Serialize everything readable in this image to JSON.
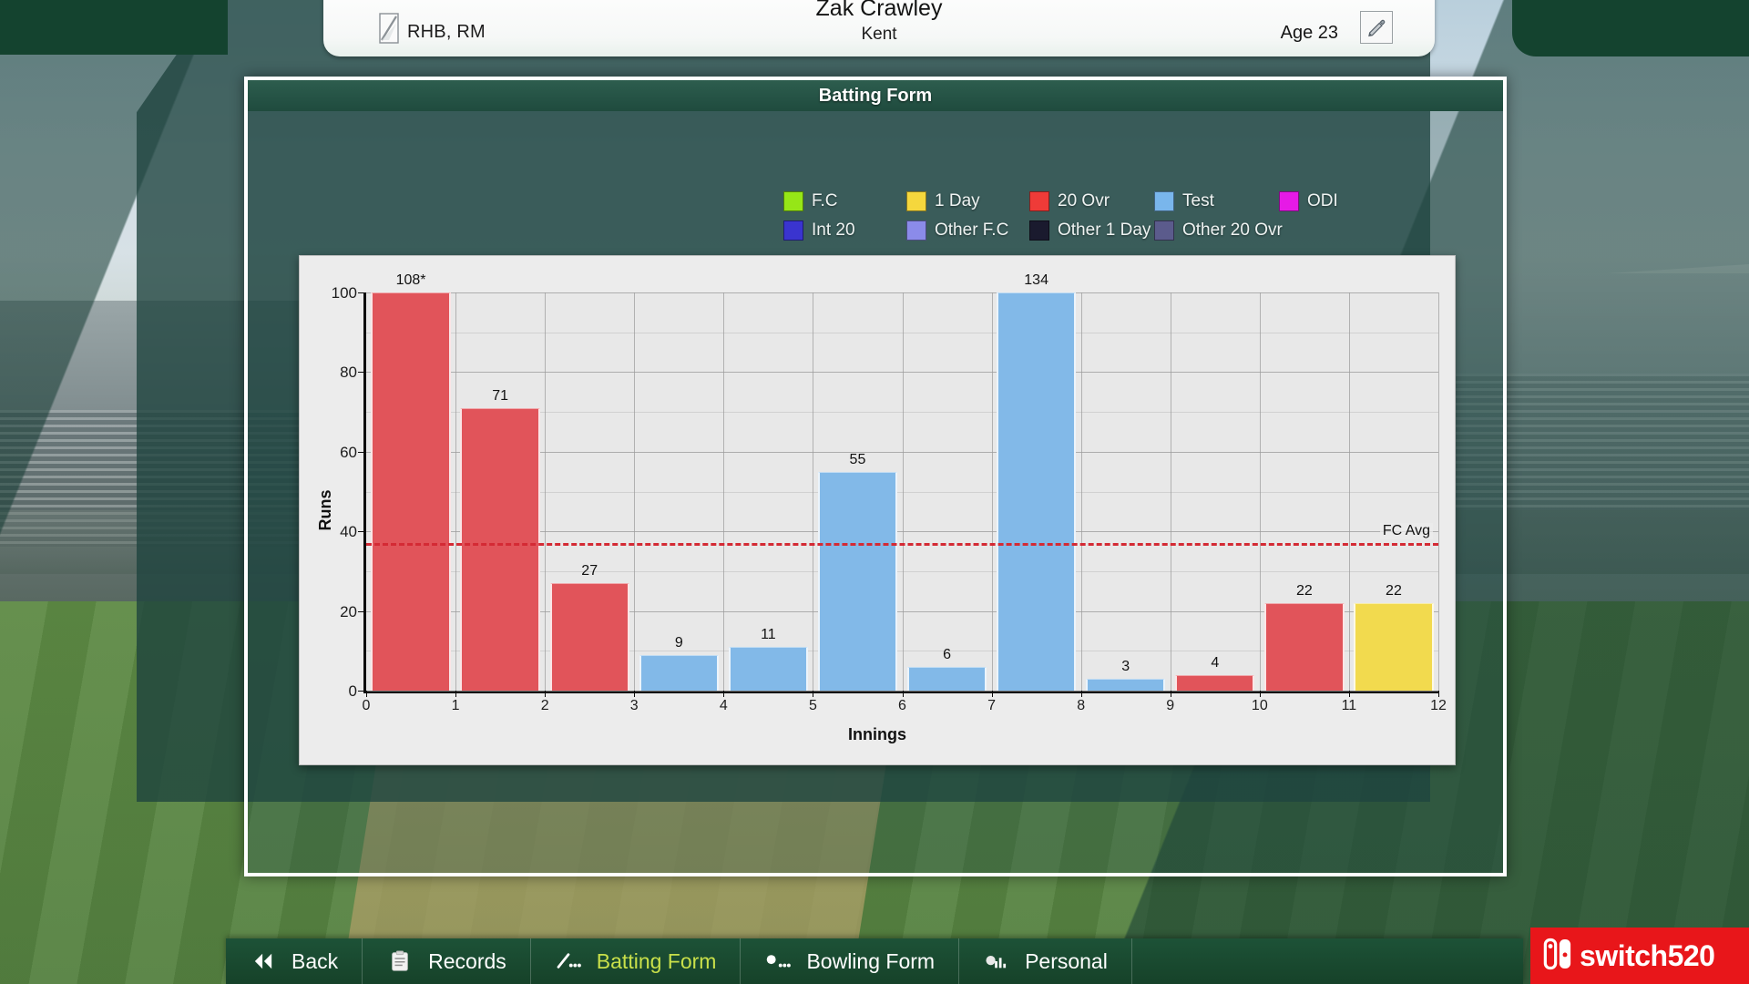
{
  "player_header": {
    "name": "Zak Crawley",
    "team": "Kent",
    "hand_style": "RHB, RM",
    "age_label": "Age 23",
    "bat_icon": "cricket-bat-icon",
    "edit_icon": "pencil-edit-icon"
  },
  "panel": {
    "title": "Batting Form"
  },
  "legend": {
    "row1": [
      {
        "label": "F.C",
        "color": "#96e617"
      },
      {
        "label": "1 Day",
        "color": "#f5d73d"
      },
      {
        "label": "20 Ovr",
        "color": "#ef3b38"
      },
      {
        "label": "Test",
        "color": "#79b6ec"
      },
      {
        "label": "ODI",
        "color": "#e61ae6"
      }
    ],
    "row2": [
      {
        "label": "Int 20",
        "color": "#3a34cf"
      },
      {
        "label": "Other F.C",
        "color": "#8b8bea"
      },
      {
        "label": "Other 1 Day",
        "color": "#1a1a2e"
      },
      {
        "label": "Other 20 Ovr",
        "color": "#5b5b8c"
      }
    ]
  },
  "chart_data": {
    "type": "bar",
    "title": "Batting Form",
    "xlabel": "Innings",
    "ylabel": "Runs",
    "ylim": [
      0,
      100
    ],
    "xlim": [
      0,
      12
    ],
    "yticks": [
      0,
      20,
      40,
      60,
      80,
      100
    ],
    "y_minor_step": 10,
    "xticks": [
      0,
      1,
      2,
      3,
      4,
      5,
      6,
      7,
      8,
      9,
      10,
      11,
      12
    ],
    "grid": true,
    "legend_position": "above-chart",
    "categories": [
      1,
      2,
      3,
      4,
      5,
      6,
      7,
      8,
      9,
      10,
      11,
      12
    ],
    "values": [
      108,
      71,
      27,
      9,
      11,
      55,
      6,
      134,
      3,
      4,
      22,
      22
    ],
    "labels": [
      "108*",
      "71",
      "27",
      "9",
      "11",
      "55",
      "6",
      "134",
      "3",
      "4",
      "22",
      "22"
    ],
    "bar_formats": [
      "20 Ovr",
      "20 Ovr",
      "20 Ovr",
      "Test",
      "Test",
      "Test",
      "Test",
      "Test",
      "Test",
      "20 Ovr",
      "20 Ovr",
      "1 Day"
    ],
    "bar_colors": [
      "#e1545a",
      "#e1545a",
      "#e1545a",
      "#82b9e8",
      "#82b9e8",
      "#82b9e8",
      "#82b9e8",
      "#82b9e8",
      "#82b9e8",
      "#e1545a",
      "#e1545a",
      "#f2da4e"
    ],
    "annotations": [
      {
        "name": "FC Avg",
        "type": "hline",
        "value": 37,
        "color": "#d42a34",
        "style": "dashed"
      }
    ]
  },
  "bottom_nav": {
    "items": [
      {
        "label": "Back",
        "icon": "double-chevron-left-icon",
        "active": false
      },
      {
        "label": "Records",
        "icon": "clipboard-icon",
        "active": false
      },
      {
        "label": "Batting Form",
        "icon": "bat-stars-icon",
        "active": true
      },
      {
        "label": "Bowling Form",
        "icon": "ball-stars-icon",
        "active": false
      },
      {
        "label": "Personal",
        "icon": "bar-chart-icon",
        "active": false
      }
    ]
  },
  "watermark": {
    "text": "switch520",
    "icon": "nintendo-switch-logo-icon",
    "color": "#e8161a"
  }
}
